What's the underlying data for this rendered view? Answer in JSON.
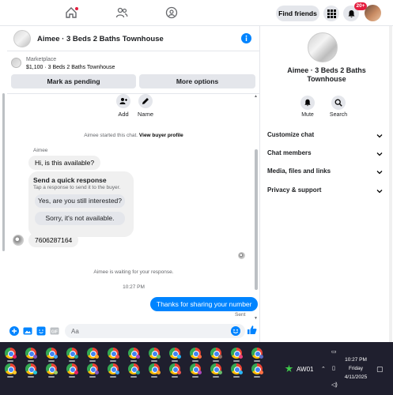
{
  "nav": {
    "home_icon": "home-icon",
    "friends_icon": "friends-icon",
    "groups_icon": "groups-icon",
    "find_friends": "Find friends",
    "menu_icon": "grid-menu-icon",
    "notifications_badge": "20+"
  },
  "chat": {
    "title": "Aimee · 3 Beds 2 Baths Townhouse",
    "marketplace_label": "Marketplace",
    "listing": "$1,100 · 3 Beds 2 Baths Townhouse",
    "mark_pending": "Mark as pending",
    "more_options": "More options",
    "actions": [
      {
        "label": "Add",
        "icon": "add-person-icon"
      },
      {
        "label": "Name",
        "icon": "pencil-icon"
      }
    ],
    "started_note": "Aimee started this chat.",
    "view_profile": "View buyer profile",
    "sender": "Aimee",
    "msg_available": "Hi, is this available?",
    "quick": {
      "title": "Send a quick response",
      "subtitle": "Tap a response to send it to the buyer.",
      "opt1": "Yes, are you still interested?",
      "opt2": "Sorry, it's not available."
    },
    "msg_phone": "7606287164",
    "waiting_note": "Aimee is waiting for your response.",
    "time": "10:27 PM",
    "msg_out": "Thanks for sharing your number",
    "sent": "Sent",
    "composer_placeholder": "Aa"
  },
  "side": {
    "title": "Aimee · 3 Beds 2 Baths Townhouse",
    "mute": "Mute",
    "search": "Search",
    "rows": [
      "Customize chat",
      "Chat members",
      "Media, files and links",
      "Privacy & support"
    ]
  },
  "taskbar": {
    "weather": "AW01",
    "time": "10:27 PM",
    "day": "Friday",
    "date": "4/11/2025"
  },
  "colors": {
    "accent": "#0084ff",
    "bubble_in": "#f0f0f0",
    "taskbar": "#1f1f2e"
  }
}
